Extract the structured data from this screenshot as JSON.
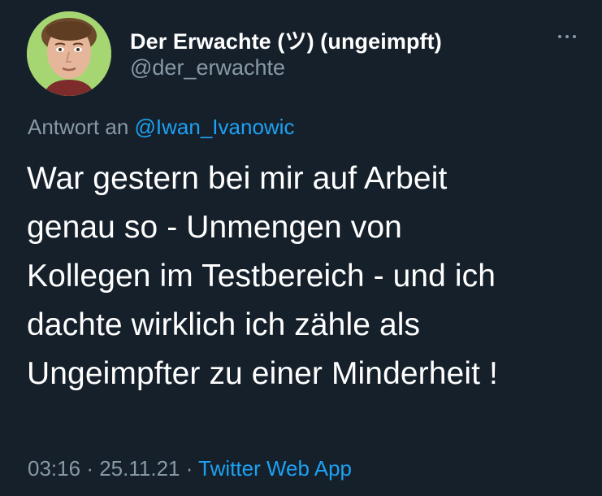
{
  "colors": {
    "background": "#15202b",
    "primary_text": "#ffffff",
    "secondary_text": "#8899a6",
    "accent": "#1da1f2"
  },
  "tweet": {
    "author": {
      "display_name": "Der Erwachte (ツ) (ungeimpft)",
      "handle": "@der_erwachte",
      "avatar_icon": "avatar-portrait-icon"
    },
    "more_icon": "more-horizontal-icon",
    "reply_prefix": "Antwort an",
    "reply_to": "@Iwan_Ivanowic",
    "text": "War gestern bei mir auf Arbeit\ngenau so - Unmengen von\nKollegen im Testbereich - und ich\ndachte wirklich ich zähle als\nUngeimpfter zu einer Minderheit !",
    "time": "03:16",
    "separator": "·",
    "date": "25.11.21",
    "source": "Twitter Web App"
  }
}
